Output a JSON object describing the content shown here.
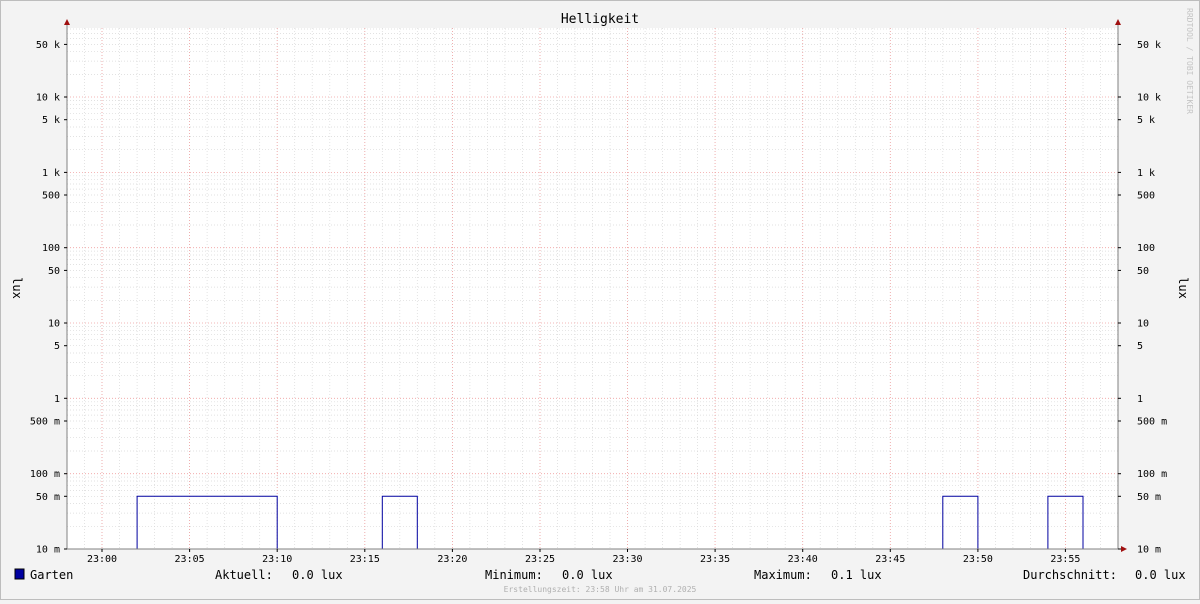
{
  "chart_data": {
    "type": "line",
    "title": "Helligkeit",
    "ylabel_left": "lux",
    "ylabel_right": "lux",
    "yscale": "log",
    "ylim": [
      0.01,
      80000
    ],
    "y_ticks": [
      {
        "value": 50000,
        "label": "50 k"
      },
      {
        "value": 10000,
        "label": "10 k"
      },
      {
        "value": 5000,
        "label": "5 k"
      },
      {
        "value": 1000,
        "label": "1 k"
      },
      {
        "value": 500,
        "label": "500"
      },
      {
        "value": 100,
        "label": "100"
      },
      {
        "value": 50,
        "label": "50"
      },
      {
        "value": 10,
        "label": "10"
      },
      {
        "value": 5,
        "label": "5"
      },
      {
        "value": 1,
        "label": "1"
      },
      {
        "value": 0.5,
        "label": "500 m"
      },
      {
        "value": 0.1,
        "label": "100 m"
      },
      {
        "value": 0.05,
        "label": "50 m"
      },
      {
        "value": 0.01,
        "label": "10 m"
      }
    ],
    "x_ticks": [
      "23:00",
      "23:05",
      "23:10",
      "23:15",
      "23:20",
      "23:25",
      "23:30",
      "23:35",
      "23:40",
      "23:45",
      "23:50",
      "23:55"
    ],
    "x_range": [
      "22:58",
      "23:58"
    ],
    "grid": true,
    "series": [
      {
        "name": "Garten",
        "color": "#0000a0",
        "points": [
          {
            "t": "22:58",
            "v": 0.01
          },
          {
            "t": "23:02",
            "v": 0.01
          },
          {
            "t": "23:02",
            "v": 0.05
          },
          {
            "t": "23:10",
            "v": 0.05
          },
          {
            "t": "23:10",
            "v": 0.01
          },
          {
            "t": "23:16",
            "v": 0.01
          },
          {
            "t": "23:16",
            "v": 0.05
          },
          {
            "t": "23:18",
            "v": 0.05
          },
          {
            "t": "23:18",
            "v": 0.01
          },
          {
            "t": "23:48",
            "v": 0.01
          },
          {
            "t": "23:48",
            "v": 0.05
          },
          {
            "t": "23:50",
            "v": 0.05
          },
          {
            "t": "23:50",
            "v": 0.01
          },
          {
            "t": "23:54",
            "v": 0.01
          },
          {
            "t": "23:54",
            "v": 0.05
          },
          {
            "t": "23:56",
            "v": 0.05
          },
          {
            "t": "23:56",
            "v": 0.01
          },
          {
            "t": "23:58",
            "v": 0.01
          }
        ]
      }
    ]
  },
  "legend": {
    "series_name": "Garten",
    "current_label": "Aktuell:",
    "current_value": "0.0 lux",
    "min_label": "Minimum:",
    "min_value": "0.0 lux",
    "max_label": "Maximum:",
    "max_value": "0.1 lux",
    "avg_label": "Durchschnitt:",
    "avg_value": "0.0 lux"
  },
  "footer": "Erstellungszeit: 23:58 Uhr am 31.07.2025",
  "watermark": "RRDTOOL / TOBI OETIKER",
  "colors": {
    "background": "#f3f3f3",
    "plot_bg": "#ffffff",
    "major_grid": "#f0a0a0",
    "minor_grid": "#d8d8d8",
    "axis": "#808080",
    "arrow": "#a01010"
  }
}
